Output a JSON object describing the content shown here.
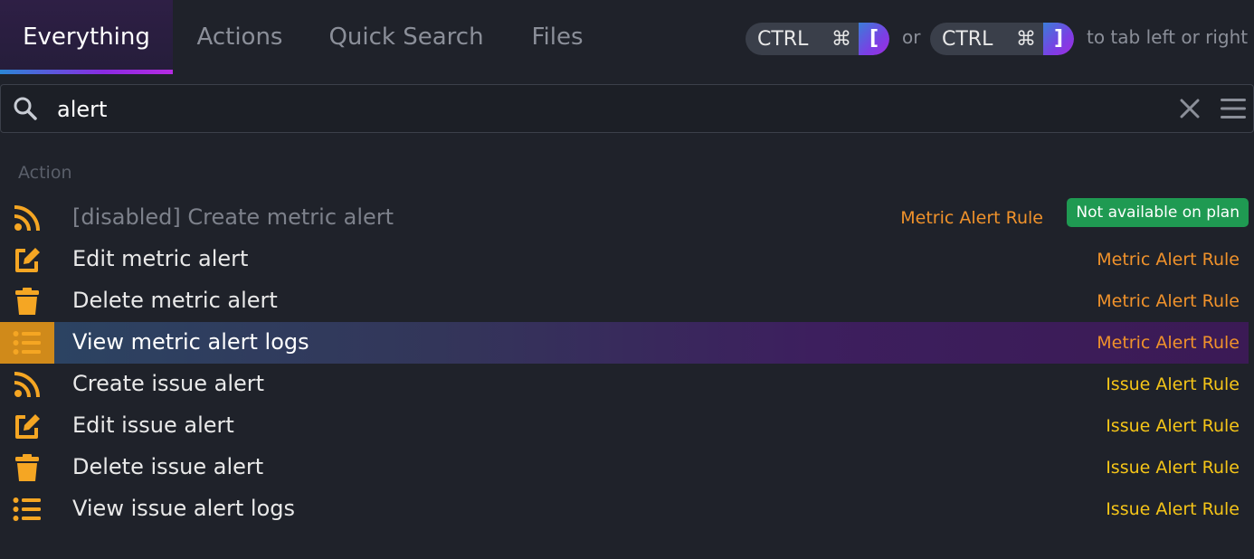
{
  "tabs": [
    {
      "label": "Everything",
      "active": true
    },
    {
      "label": "Actions",
      "active": false
    },
    {
      "label": "Quick Search",
      "active": false
    },
    {
      "label": "Files",
      "active": false
    }
  ],
  "hint": {
    "ctrl": "CTRL",
    "cmd": "⌘",
    "left_bracket": "[",
    "right_bracket": "]",
    "or": "or",
    "suffix": "to tab left or right"
  },
  "search": {
    "value": "alert"
  },
  "list": {
    "section_label": "Action",
    "items": [
      {
        "label": "[disabled] Create metric alert",
        "category": "Metric Alert Rule",
        "icon": "rss-icon",
        "badge": "Not available on plan",
        "disabled": true
      },
      {
        "label": "Edit metric alert",
        "category": "Metric Alert Rule",
        "icon": "edit-icon"
      },
      {
        "label": "Delete metric alert",
        "category": "Metric Alert Rule",
        "icon": "trash-icon"
      },
      {
        "label": "View metric alert logs",
        "category": "Metric Alert Rule",
        "icon": "list-icon",
        "selected": true
      },
      {
        "label": "Create issue alert",
        "category": "Issue Alert Rule",
        "icon": "rss-icon"
      },
      {
        "label": "Edit issue alert",
        "category": "Issue Alert Rule",
        "icon": "edit-icon"
      },
      {
        "label": "Delete issue alert",
        "category": "Issue Alert Rule",
        "icon": "trash-icon"
      },
      {
        "label": "View issue alert logs",
        "category": "Issue Alert Rule",
        "icon": "list-icon"
      }
    ]
  },
  "colors": {
    "background": "#1f222a",
    "icon": "#f5a623",
    "metric_category": "#f0922b",
    "issue_category": "#f5c518",
    "badge": "#1f9a52"
  }
}
